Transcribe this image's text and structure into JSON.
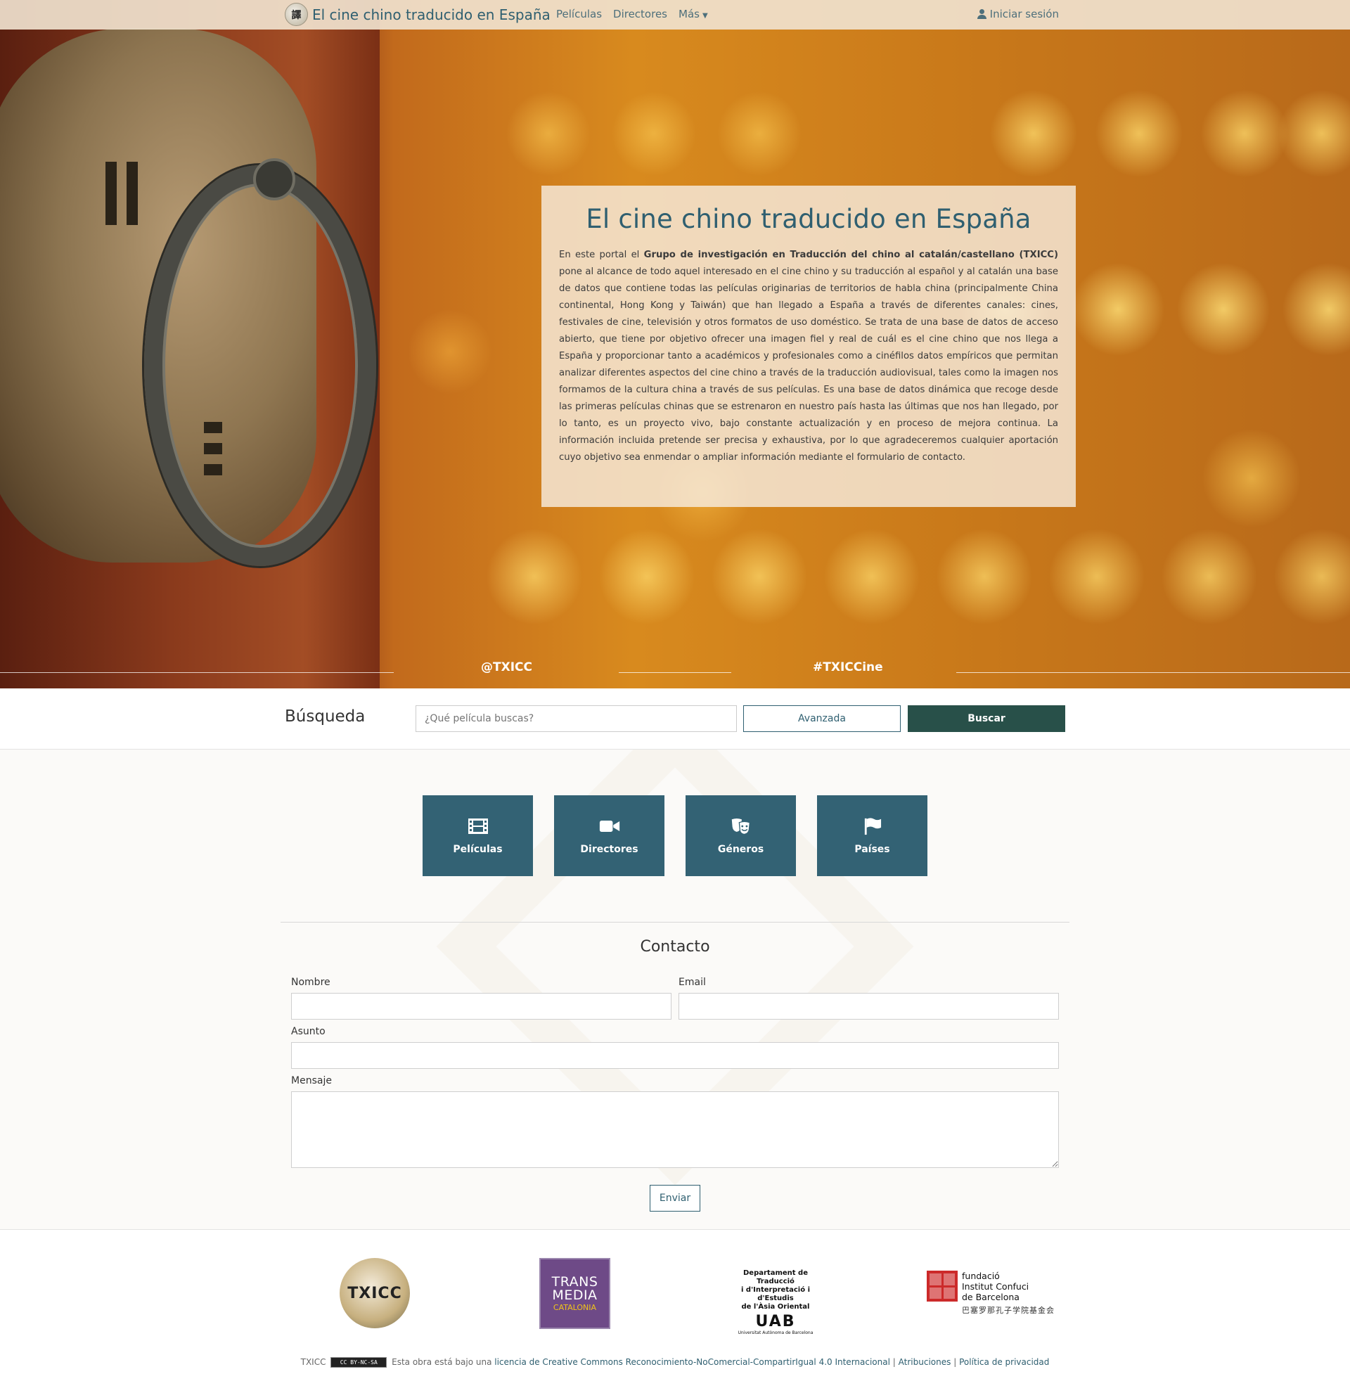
{
  "navbar": {
    "brand_title": "El cine chino traducido en España",
    "brand_logo_text": "譯",
    "links": [
      "Películas",
      "Directores",
      "Más"
    ],
    "login_label": "Iniciar sesión"
  },
  "hero": {
    "title": "El cine chino traducido en España",
    "intro_prefix": "En este portal el ",
    "intro_bold": "Grupo de investigación en Traducción del chino al catalán/castellano (TXICC)",
    "intro_rest": " pone al alcance de todo aquel interesado en el cine chino y su traducción al español y al catalán una base de datos que contiene todas las películas originarias de territorios de habla china (principalmente China continental, Hong Kong y Taiwán) que han llegado a España a través de diferentes canales: cines, festivales de cine, televisión y otros formatos de uso doméstico. Se trata de una base de datos de acceso abierto, que tiene por objetivo ofrecer una imagen fiel y real de cuál es el cine chino que nos llega a España y proporcionar tanto a académicos y profesionales como a cinéfilos datos empíricos que permitan analizar diferentes aspectos del cine chino a través de la traducción audiovisual, tales como la imagen nos formamos de la cultura china a través de sus películas. Es una base de datos dinámica que recoge desde las primeras películas chinas que se estrenaron en nuestro país hasta las últimas que nos han llegado, por lo tanto, es un proyecto vivo, bajo constante actualización y en proceso de mejora continua. La información incluida pretende ser precisa y exhaustiva, por lo que agradeceremos cualquier aportación cuyo objetivo sea enmendar o ampliar información mediante el formulario de contacto.",
    "social_handle": "@TXICC",
    "social_hashtag": "#TXICCine"
  },
  "search": {
    "title": "Búsqueda",
    "placeholder": "¿Qué película buscas?",
    "advanced_label": "Avanzada",
    "search_label": "Buscar"
  },
  "tiles": [
    {
      "label": "Películas",
      "icon": "film-icon"
    },
    {
      "label": "Directores",
      "icon": "video-camera-icon"
    },
    {
      "label": "Géneros",
      "icon": "theater-masks-icon"
    },
    {
      "label": "Países",
      "icon": "flag-icon"
    }
  ],
  "contact": {
    "title": "Contacto",
    "name_label": "Nombre",
    "email_label": "Email",
    "subject_label": "Asunto",
    "message_label": "Mensaje",
    "name_value": "",
    "email_value": "",
    "subject_value": "",
    "message_value": "",
    "send_label": "Enviar"
  },
  "footer": {
    "logos": {
      "txicc": "TXICC",
      "transmedia_1": "TRANS",
      "transmedia_2": "MEDIA",
      "transmedia_3": "CATALONIA",
      "uab_line1": "Departament de Traducció",
      "uab_line2": "i d'Interpretació i d'Estudis",
      "uab_line3": "de l'Àsia Oriental",
      "uab_mark": "UAB",
      "uab_sub": "Universitat Autònoma de Barcelona",
      "ic_line1": "fundació",
      "ic_line2": "Institut Confuci",
      "ic_line3": "de Barcelona",
      "ic_cn": "巴塞罗那孔子学院基金会"
    },
    "license_prefix": "TXICC",
    "cc_badge": "CC BY-NC-SA",
    "license_text": "Esta obra está bajo una",
    "license_link": "licencia de Creative Commons Reconocimiento-NoComercial-CompartirIgual 4.0 Internacional",
    "attributions": "Atribuciones",
    "privacy": "Política de privacidad",
    "sep": "|"
  }
}
